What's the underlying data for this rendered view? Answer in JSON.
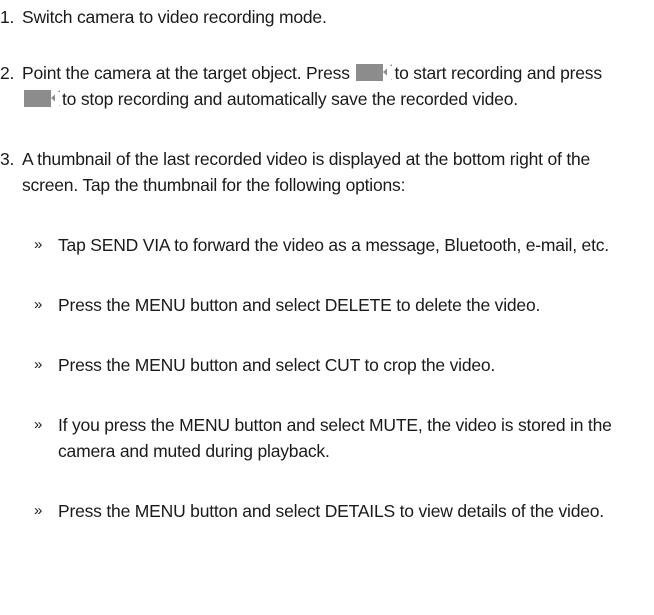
{
  "steps": [
    {
      "number": "1.",
      "text": "Switch camera to video recording mode."
    },
    {
      "number": "2.",
      "text_a": "Point the camera at the target object. Press",
      "text_b": "to start recording and press",
      "text_c": "to stop recording and automatically save the recorded video.",
      "icon": "record-button-icon"
    },
    {
      "number": "3.",
      "text": "A thumbnail of the last recorded video is displayed at the bottom right of the screen. Tap the thumbnail for the following options:"
    }
  ],
  "bullet_mark": "»",
  "bullets": [
    "Tap SEND VIA to forward the video as a message, Bluetooth, e-mail, etc.",
    "Press the MENU button and select DELETE to delete the video.",
    "Press the MENU button and select CUT to crop the video.",
    "If you press the MENU button and select MUTE, the video is stored in the camera and muted during playback.",
    "Press the MENU button and select DETAILS to view details of the video."
  ],
  "icon_color": "#8c8c8c"
}
